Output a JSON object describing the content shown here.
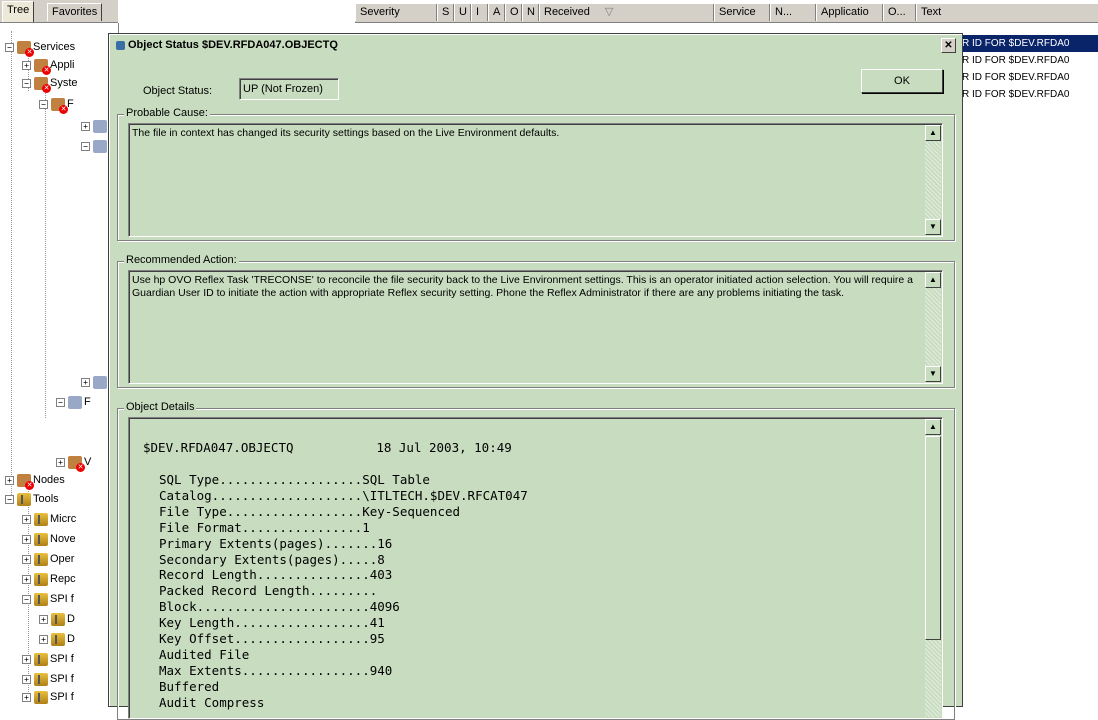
{
  "left_pane": {
    "tabs": [
      "Tree",
      "Favorites"
    ],
    "tree": [
      {
        "label": "Services",
        "icon": "red-service-icon",
        "pm": "−"
      },
      {
        "label": "Appli",
        "icon": "red-service-icon",
        "pm": "+"
      },
      {
        "label": "Syste",
        "icon": "red-service-icon",
        "pm": "−"
      },
      {
        "label": "F",
        "icon": "red-service-icon",
        "pm": "−"
      },
      {
        "label": "",
        "icon": "service-icon",
        "pm": "+"
      },
      {
        "label": "",
        "icon": "service-icon",
        "pm": "−"
      },
      {
        "label": "Nodes",
        "icon": "red-folder-icon",
        "pm": "+"
      },
      {
        "label": "Tools",
        "icon": "tool-icon",
        "pm": "−"
      },
      {
        "label": "Micrc",
        "icon": "tool-icon",
        "pm": "+"
      },
      {
        "label": "Nove",
        "icon": "tool-icon",
        "pm": "+"
      },
      {
        "label": "Oper",
        "icon": "tool-icon",
        "pm": "+"
      },
      {
        "label": "Repc",
        "icon": "tool-icon",
        "pm": "+"
      },
      {
        "label": "SPI f",
        "icon": "tool-icon",
        "pm": "−"
      },
      {
        "label": "D",
        "icon": "tool-icon",
        "pm": "+"
      },
      {
        "label": "D",
        "icon": "tool-icon",
        "pm": "+"
      },
      {
        "label": "SPI f",
        "icon": "tool-icon",
        "pm": "+"
      },
      {
        "label": "SPI f",
        "icon": "tool-icon",
        "pm": "+"
      },
      {
        "label": "SPI f",
        "icon": "tool-icon",
        "pm": "+"
      }
    ],
    "extra_nodes": [
      {
        "label": "",
        "pm": "+"
      },
      {
        "label": "F",
        "pm": "−"
      },
      {
        "label": "V",
        "pm": "+"
      }
    ]
  },
  "list": {
    "columns": [
      "Severity",
      "S",
      "U",
      "I",
      "A",
      "O",
      "N",
      "Received",
      "Service",
      "N...",
      "Applicatio",
      "O...",
      "Text"
    ],
    "rows": [
      "R ID FOR $DEV.RFDA0",
      "R ID FOR $DEV.RFDA0",
      "R ID FOR $DEV.RFDA0",
      "R ID FOR $DEV.RFDA0"
    ]
  },
  "dialog": {
    "title": "Object Status $DEV.RFDA047.OBJECTQ",
    "close_glyph": "✕",
    "status_label": "Object Status:",
    "status_value": "UP (Not Frozen)",
    "ok_label": "OK",
    "probable_cause": {
      "label": "Probable Cause:",
      "text": "The file in context has changed its security settings based on the Live Environment defaults."
    },
    "recommended_action": {
      "label": "Recommended Action:",
      "text": "Use hp OVO Reflex Task 'TRECONSE' to reconcile the file security back to the Live Environment settings. This is an operator initiated action selection. You will require a Guardian User ID to initiate the action with appropriate Reflex security setting. Phone the Reflex Administrator if there are any problems initiating the task."
    },
    "object_details": {
      "label": "Object Details",
      "header_name": "$DEV.RFDA047.OBJECTQ",
      "header_date": "18 Jul 2003, 10:49",
      "lines": [
        "SQL Type...................SQL Table",
        "Catalog....................\\ITLTECH.$DEV.RFCAT047",
        "File Type..................Key-Sequenced",
        "File Format................1",
        "Primary Extents(pages).......16",
        "Secondary Extents(pages).....8",
        "Record Length...............403",
        "Packed Record Length.........",
        "Block.......................4096",
        "Key Length..................41",
        "Key Offset..................95",
        "Audited File",
        "Max Extents.................940",
        "Buffered",
        "Audit Compress"
      ]
    }
  }
}
